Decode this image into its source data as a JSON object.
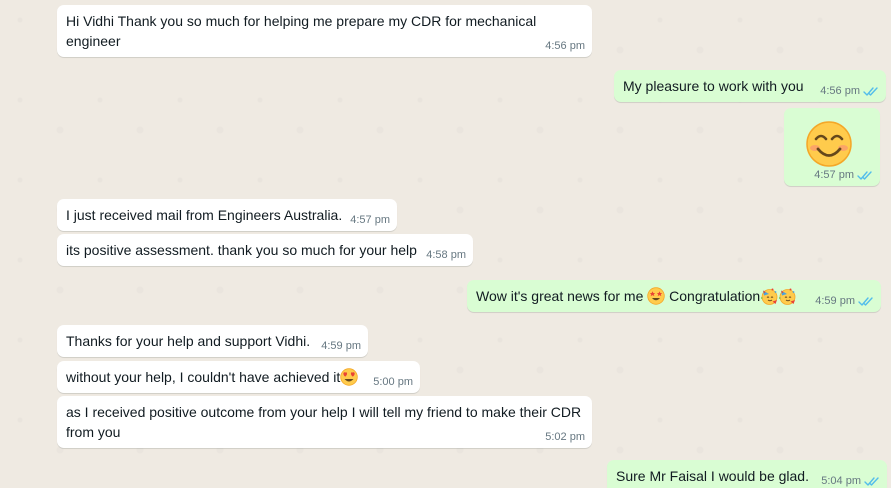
{
  "conversation": {
    "messages": [
      {
        "id": "m1",
        "direction": "in",
        "text": "Hi Vidhi Thank you so much for helping me prepare my CDR for mechanical engineer",
        "time": "4:56 pm"
      },
      {
        "id": "m2",
        "direction": "out",
        "text": "My pleasure to work with you",
        "time": "4:56 pm",
        "status": "read"
      },
      {
        "id": "m3",
        "direction": "out",
        "emoji": "smiling-face-emoji",
        "time": "4:57 pm",
        "status": "read"
      },
      {
        "id": "m4",
        "direction": "in",
        "text": "I just received mail from Engineers Australia.",
        "time": "4:57 pm"
      },
      {
        "id": "m5",
        "direction": "in",
        "text": "its positive assessment. thank you so much for your help",
        "time": "4:58 pm"
      },
      {
        "id": "m6",
        "direction": "out",
        "text_a": "Wow it's great news for me",
        "text_b": "Congratulation",
        "emojis": [
          "star-struck-emoji",
          "partying-face-emoji",
          "partying-face-emoji"
        ],
        "time": "4:59 pm",
        "status": "read"
      },
      {
        "id": "m7",
        "direction": "in",
        "text": "Thanks for your help and support Vidhi.",
        "time": "4:59 pm"
      },
      {
        "id": "m8",
        "direction": "in",
        "text": "without your help, I couldn't have achieved it",
        "emoji": "heart-eyes-emoji",
        "time": "5:00 pm"
      },
      {
        "id": "m9",
        "direction": "in",
        "text": "as I received positive outcome from your help I will tell my friend to make their CDR from you",
        "time": "5:02 pm"
      },
      {
        "id": "m10",
        "direction": "out",
        "text": "Sure Mr Faisal I would be glad.",
        "time": "5:04 pm",
        "status": "read"
      }
    ]
  },
  "colors": {
    "chat_background": "#efeae2",
    "incoming_bubble": "#ffffff",
    "outgoing_bubble": "#d9fdd3",
    "read_ticks": "#53bdeb",
    "timestamp": "#667781"
  }
}
